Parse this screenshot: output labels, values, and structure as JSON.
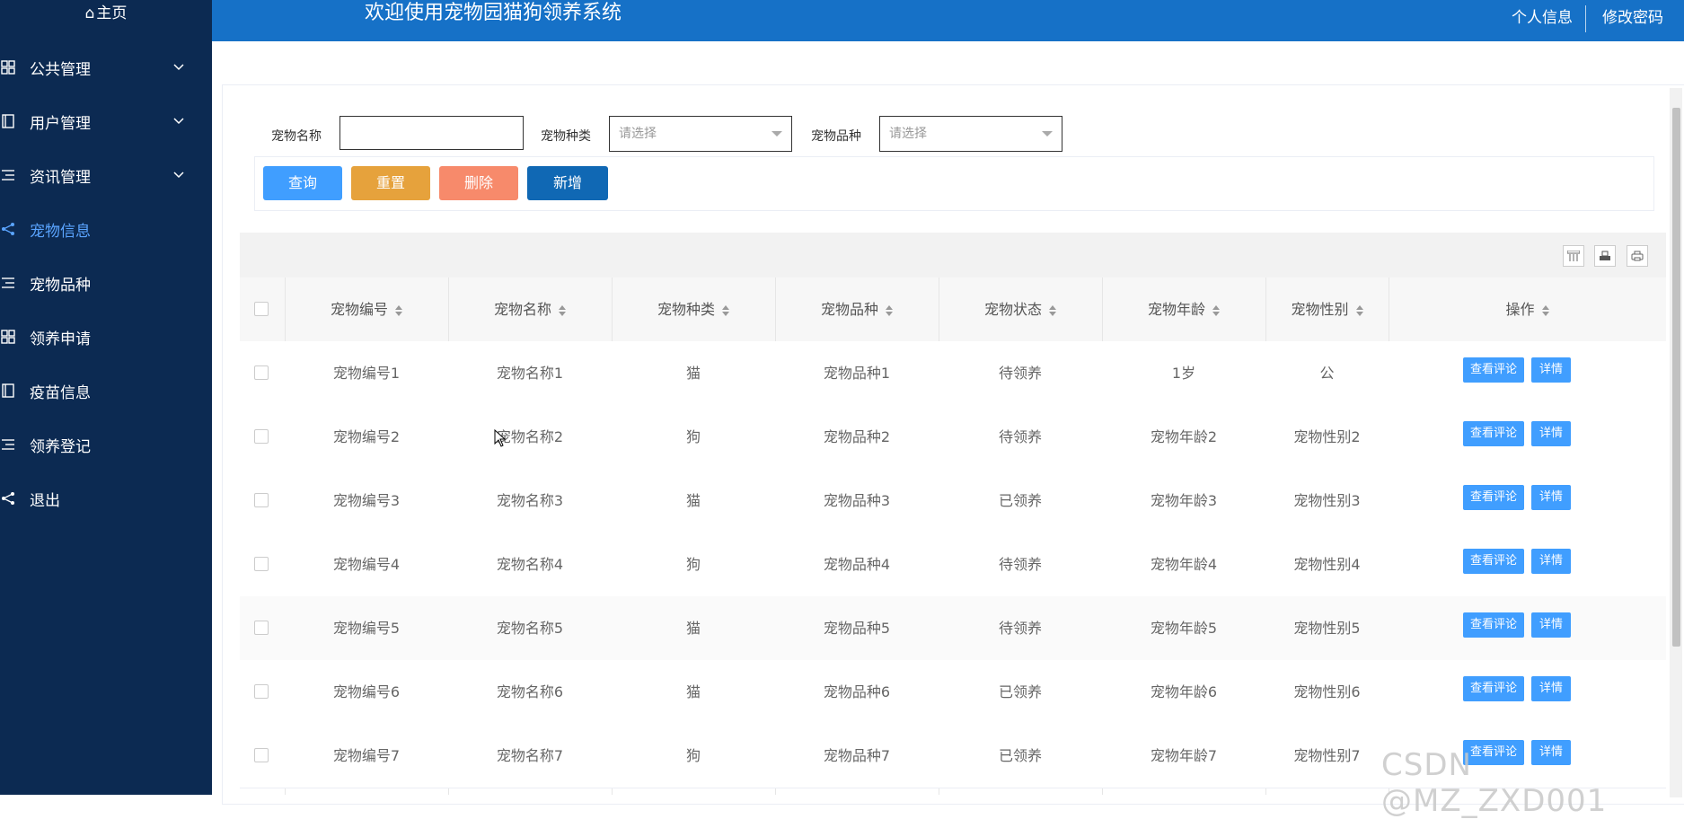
{
  "sidebar": {
    "home": "主页",
    "items": [
      {
        "label": "公共管理",
        "icon": "grid-icon",
        "has_chevron": true
      },
      {
        "label": "用户管理",
        "icon": "book-icon",
        "has_chevron": true
      },
      {
        "label": "资讯管理",
        "icon": "list-icon",
        "has_chevron": true
      },
      {
        "label": "宠物信息",
        "icon": "share-icon",
        "active": true
      },
      {
        "label": "宠物品种",
        "icon": "list-icon"
      },
      {
        "label": "领养申请",
        "icon": "grid-icon"
      },
      {
        "label": "疫苗信息",
        "icon": "book-icon"
      },
      {
        "label": "领养登记",
        "icon": "list-icon"
      },
      {
        "label": "退出",
        "icon": "share-icon"
      }
    ]
  },
  "header": {
    "title": "欢迎使用宠物园猫狗领养系统",
    "profile": "个人信息",
    "change_password": "修改密码"
  },
  "filters": {
    "name_label": "宠物名称",
    "name_value": "",
    "type_label": "宠物种类",
    "type_placeholder": "请选择",
    "breed_label": "宠物品种",
    "breed_placeholder": "请选择"
  },
  "actions": {
    "query": "查询",
    "reset": "重置",
    "delete": "删除",
    "add": "新增"
  },
  "colors": {
    "sidebar_bg": "#0c2a52",
    "header_bg": "#1671c7",
    "query": "#409eff",
    "reset": "#e6a23c",
    "delete": "#f78a6b",
    "add": "#1068b4",
    "op_button": "#409eff"
  },
  "table": {
    "columns": [
      "宠物编号",
      "宠物名称",
      "宠物种类",
      "宠物品种",
      "宠物状态",
      "宠物年龄",
      "宠物性别",
      "操作"
    ],
    "op_comment": "查看评论",
    "op_detail": "详情",
    "rows": [
      [
        "宠物编号1",
        "宠物名称1",
        "猫",
        "宠物品种1",
        "待领养",
        "1岁",
        "公"
      ],
      [
        "宠物编号2",
        "宠物名称2",
        "狗",
        "宠物品种2",
        "待领养",
        "宠物年龄2",
        "宠物性别2"
      ],
      [
        "宠物编号3",
        "宠物名称3",
        "猫",
        "宠物品种3",
        "已领养",
        "宠物年龄3",
        "宠物性别3"
      ],
      [
        "宠物编号4",
        "宠物名称4",
        "狗",
        "宠物品种4",
        "待领养",
        "宠物年龄4",
        "宠物性别4"
      ],
      [
        "宠物编号5",
        "宠物名称5",
        "猫",
        "宠物品种5",
        "待领养",
        "宠物年龄5",
        "宠物性别5"
      ],
      [
        "宠物编号6",
        "宠物名称6",
        "猫",
        "宠物品种6",
        "已领养",
        "宠物年龄6",
        "宠物性别6"
      ],
      [
        "宠物编号7",
        "宠物名称7",
        "狗",
        "宠物品种7",
        "已领养",
        "宠物年龄7",
        "宠物性别7"
      ]
    ]
  },
  "watermark": "CSDN @MZ_ZXD001"
}
